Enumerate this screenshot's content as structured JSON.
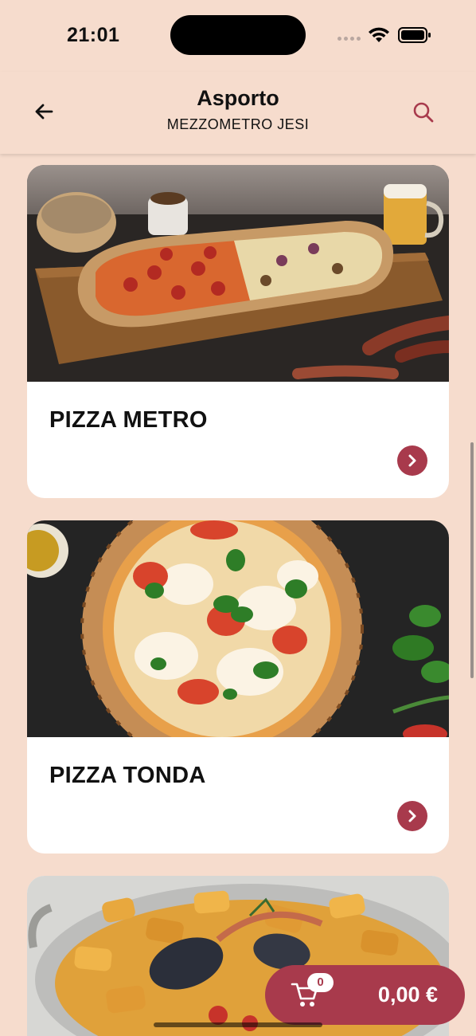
{
  "status_bar": {
    "time": "21:01"
  },
  "header": {
    "title": "Asporto",
    "subtitle": "MEZZOMETRO JESI",
    "back_icon": "arrow-left-icon",
    "search_icon": "search-icon"
  },
  "categories": [
    {
      "title": "PIZZA METRO"
    },
    {
      "title": "PIZZA TONDA"
    },
    {
      "title": ""
    }
  ],
  "cart": {
    "count": "0",
    "total": "0,00 €"
  },
  "colors": {
    "background": "#f6dccd",
    "accent": "#a83a4c",
    "card": "#ffffff"
  }
}
